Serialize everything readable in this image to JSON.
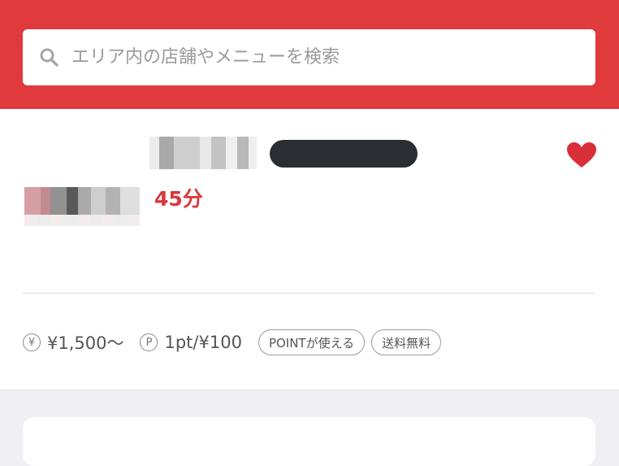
{
  "search": {
    "placeholder": "エリア内の店舗やメニューを検索"
  },
  "shop": {
    "delivery_time": "45分",
    "price": "¥1,500〜",
    "points": "1pt/¥100",
    "price_icon_glyph": "¥",
    "points_icon_glyph": "P",
    "tags": [
      "POINTが使える",
      "送料無料"
    ],
    "favorited": true
  },
  "colors": {
    "brand_red": "#e03a3c",
    "accent_red": "#d8373c",
    "heart": "#d92f3a"
  },
  "icons": {
    "search": "search-icon",
    "favorite": "heart-icon",
    "price": "yen-circle-icon",
    "points": "p-circle-icon"
  }
}
